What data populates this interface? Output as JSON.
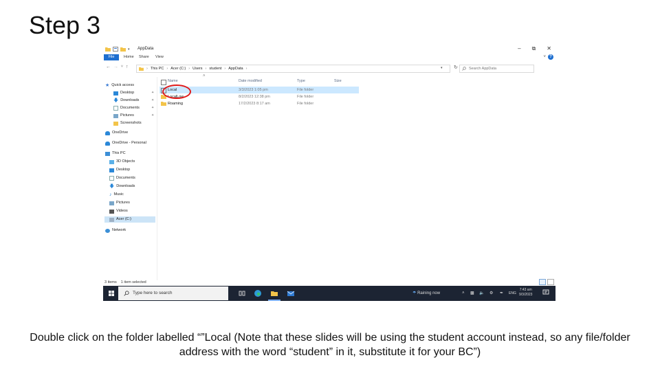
{
  "slide": {
    "title": "Step 3",
    "caption": "Double click on the folder labelled “”Local  (Note that these slides will be using the student account instead, so any file/folder address with the word “student” in it, substitute it for your BC”)"
  },
  "window": {
    "title": "AppData",
    "controls": {
      "minimize": "–",
      "maximize": "⧉",
      "close": "✕"
    }
  },
  "ribbon": {
    "tabs": [
      "File",
      "Home",
      "Share",
      "View"
    ],
    "help": "?",
    "collapse": "˅"
  },
  "nav": {
    "back": "←",
    "forward": "→",
    "recent": "˅",
    "up": "↑",
    "breadcrumb": [
      "This PC",
      "Acer (C:)",
      "Users",
      "student",
      "AppData"
    ],
    "search_placeholder": "Search AppData"
  },
  "sidebar": {
    "items": [
      {
        "label": "Quick access",
        "icon": "star-icon"
      },
      {
        "label": "Desktop",
        "icon": "desktop-icon"
      },
      {
        "label": "Downloads",
        "icon": "download-icon"
      },
      {
        "label": "Documents",
        "icon": "documents-icon"
      },
      {
        "label": "Pictures",
        "icon": "pictures-icon"
      },
      {
        "label": "Screenshots",
        "icon": "folder-icon"
      },
      {
        "label": "OneDrive",
        "icon": "cloud-icon"
      },
      {
        "label": "OneDrive - Personal",
        "icon": "cloud-icon"
      },
      {
        "label": "This PC",
        "icon": "pc-icon"
      },
      {
        "label": "3D Objects",
        "icon": "cube-icon"
      },
      {
        "label": "Desktop",
        "icon": "desktop-icon"
      },
      {
        "label": "Documents",
        "icon": "documents-icon"
      },
      {
        "label": "Downloads",
        "icon": "download-icon"
      },
      {
        "label": "Music",
        "icon": "music-icon"
      },
      {
        "label": "Pictures",
        "icon": "pictures-icon"
      },
      {
        "label": "Videos",
        "icon": "video-icon"
      },
      {
        "label": "Acer (C:)",
        "icon": "drive-icon"
      },
      {
        "label": "Network",
        "icon": "network-icon"
      }
    ]
  },
  "columns": [
    "Name",
    "Date modified",
    "Type",
    "Size"
  ],
  "files": [
    {
      "name": "Local",
      "date": "3/3/2023 1:05 pm",
      "type": "File folder"
    },
    {
      "name": "LocalLow",
      "date": "8/2/2023 12:38 pm",
      "type": "File folder"
    },
    {
      "name": "Roaming",
      "date": "17/2/2023 8:17 am",
      "type": "File folder"
    }
  ],
  "status": {
    "items": "3 items",
    "selected": "1 item selected"
  },
  "taskbar": {
    "search_placeholder": "Type here to search",
    "weather": "Raining now",
    "lang": "ENG",
    "time": "7:43 am",
    "date": "9/3/2023"
  },
  "colors": {
    "accent": "#1e6fd0",
    "selection": "#cce8ff",
    "annotation": "#e01818",
    "taskbar": "#1c2433"
  }
}
